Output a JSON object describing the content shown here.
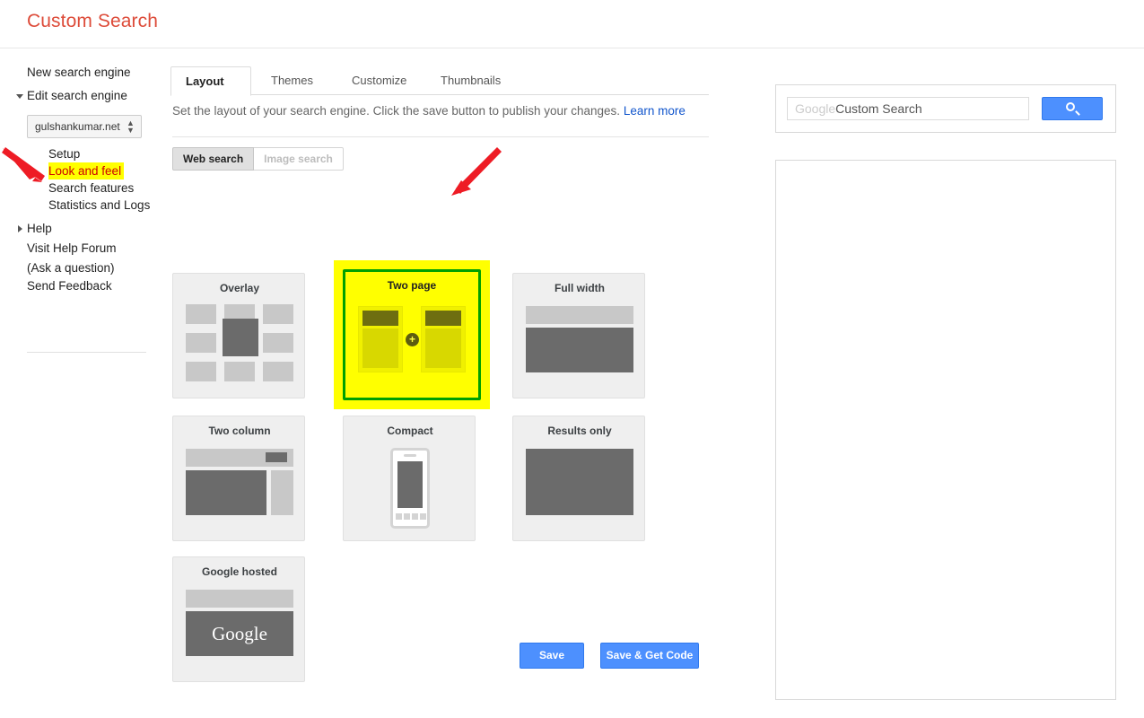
{
  "header": {
    "title": "Custom Search"
  },
  "sidebar": {
    "new_search_engine": "New search engine",
    "edit_search_engine": "Edit search engine",
    "engine_value": "gulshankumar.net",
    "sub_items": [
      {
        "label": "Setup",
        "highlighted": false
      },
      {
        "label": "Look and feel",
        "highlighted": true
      },
      {
        "label": "Search features",
        "highlighted": false
      },
      {
        "label": "Statistics and Logs",
        "highlighted": false
      }
    ],
    "help": "Help",
    "visit_help_forum_line1": "Visit Help Forum",
    "visit_help_forum_line2": "(Ask a question)",
    "send_feedback": "Send Feedback"
  },
  "main": {
    "tabs": [
      {
        "label": "Layout",
        "active": true
      },
      {
        "label": "Themes",
        "active": false
      },
      {
        "label": "Customize",
        "active": false
      },
      {
        "label": "Thumbnails",
        "active": false
      }
    ],
    "description": "Set the layout of your search engine. Click the save button to publish your changes.",
    "learn_more": "Learn more",
    "segments": [
      {
        "label": "Web search",
        "selected": true
      },
      {
        "label": "Image search",
        "selected": false
      }
    ],
    "layouts": [
      {
        "id": "overlay",
        "label": "Overlay",
        "selected": false
      },
      {
        "id": "two-page",
        "label": "Two page",
        "selected": true
      },
      {
        "id": "full-width",
        "label": "Full width",
        "selected": false
      },
      {
        "id": "two-column",
        "label": "Two column",
        "selected": false
      },
      {
        "id": "compact",
        "label": "Compact",
        "selected": false
      },
      {
        "id": "results-only",
        "label": "Results only",
        "selected": false
      },
      {
        "id": "google-hosted",
        "label": "Google hosted",
        "selected": false
      }
    ],
    "google_wordmark": "Google",
    "save_label": "Save",
    "save_get_code_label": "Save & Get Code"
  },
  "preview": {
    "search_ghost": "Google",
    "search_value": "Custom Search",
    "search_button_icon": "search-icon"
  },
  "annotations": {
    "highlight_color": "#ffff00",
    "arrow_color": "#ee1c25",
    "selected_border_color": "#00a000"
  }
}
